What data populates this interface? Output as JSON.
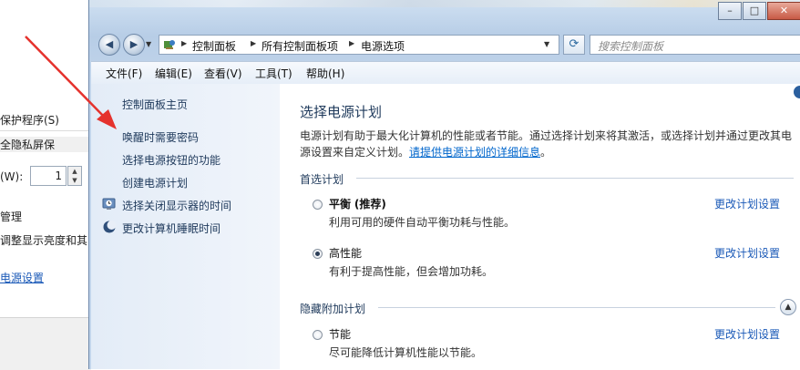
{
  "background_window": {
    "row1": "保护程序(S)",
    "row2": "全隐私屏保",
    "row3": "(W):",
    "spin_value": "1",
    "row4": "管理",
    "row5": "调整显示亮度和其",
    "link": "电源设置"
  },
  "window": {
    "caption": {
      "min": "–",
      "max": "□",
      "close": "✕"
    },
    "address": {
      "crumbs": [
        "控制面板",
        "所有控制面板项",
        "电源选项"
      ],
      "search_placeholder": "搜索控制面板"
    },
    "menu": [
      "文件(F)",
      "编辑(E)",
      "查看(V)",
      "工具(T)",
      "帮助(H)"
    ],
    "left_pane": {
      "home": "控制面板主页",
      "items": [
        "唤醒时需要密码",
        "选择电源按钮的功能",
        "创建电源计划",
        "选择关闭显示器的时间",
        "更改计算机睡眠时间"
      ]
    },
    "content": {
      "title": "选择电源计划",
      "description": "电源计划有助于最大化计算机的性能或者节能。通过选择计划来将其激活，或选择计划并通过更改其电源设置来自定义计划。",
      "description_link": "请提供电源计划的详细信息",
      "preferred_header": "首选计划",
      "hidden_header": "隐藏附加计划",
      "plans": [
        {
          "name": "平衡",
          "tag": "(推荐)",
          "desc": "利用可用的硬件自动平衡功耗与性能。",
          "link": "更改计划设置",
          "selected": false
        },
        {
          "name": "高性能",
          "tag": "",
          "desc": "有利于提高性能，但会增加功耗。",
          "link": "更改计划设置",
          "selected": true
        },
        {
          "name": "节能",
          "tag": "",
          "desc": "尽可能降低计算机性能以节能。",
          "link": "更改计划设置",
          "selected": false
        }
      ]
    }
  },
  "colors": {
    "link": "#1a59b7",
    "arrow": "#e5322d",
    "title": "#1e395b"
  }
}
